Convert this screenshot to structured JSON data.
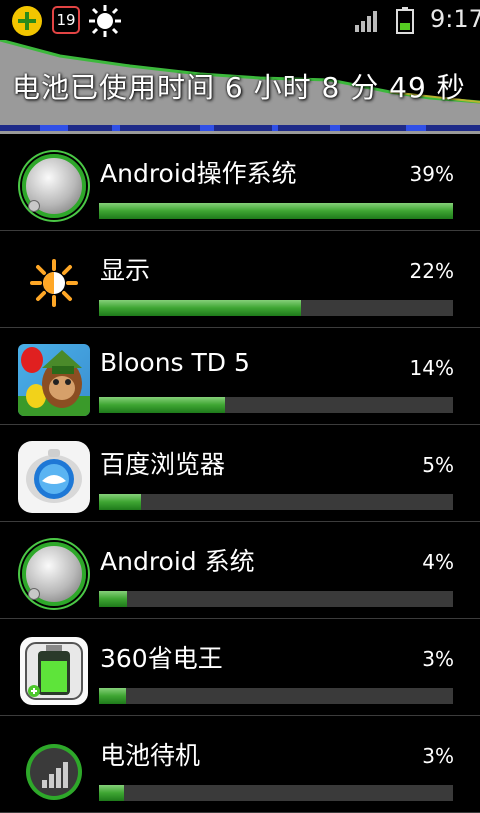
{
  "status_bar": {
    "badge_count": "19",
    "time": "9:17",
    "icons": [
      "plus-app-icon",
      "notification-badge-icon",
      "sun-icon",
      "signal-icon",
      "battery-icon"
    ]
  },
  "header": {
    "title": "电池已使用时间 6 小时 8 分 49 秒"
  },
  "items": [
    {
      "label": "Android操作系统",
      "percent": "39%",
      "usage": 1.0,
      "icon": "android-os-icon"
    },
    {
      "label": "显示",
      "percent": "22%",
      "usage": 0.57,
      "icon": "display-sun-icon"
    },
    {
      "label": "Bloons  TD  5",
      "percent": "14%",
      "usage": 0.355,
      "icon": "bloons-td5-icon"
    },
    {
      "label": "百度浏览器",
      "percent": "5%",
      "usage": 0.12,
      "icon": "baidu-browser-icon"
    },
    {
      "label": "Android  系统",
      "percent": "4%",
      "usage": 0.08,
      "icon": "android-system-icon"
    },
    {
      "label": "360省电王",
      "percent": "3%",
      "usage": 0.075,
      "icon": "360-power-saver-icon"
    },
    {
      "label": "电池待机",
      "percent": "3%",
      "usage": 0.07,
      "icon": "battery-standby-icon"
    }
  ],
  "colors": {
    "bar_fill": "#3ea532",
    "bar_track": "#3a3a3a",
    "graph_line": "#3cb83c",
    "graph_fill": "#999999"
  }
}
